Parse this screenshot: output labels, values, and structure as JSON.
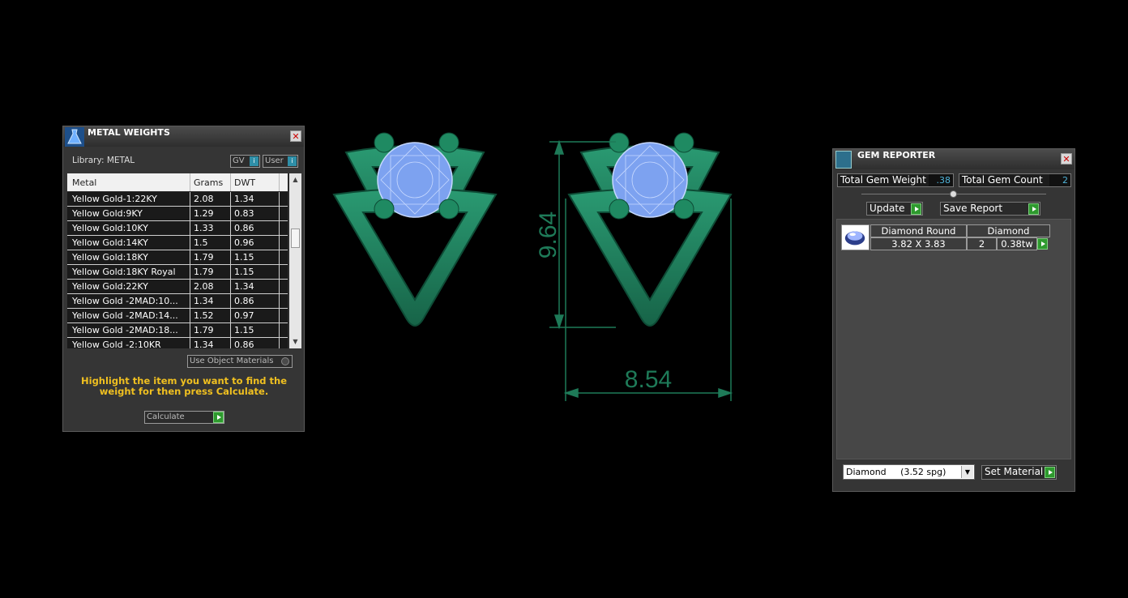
{
  "metal_weights": {
    "title": "METAL WEIGHTS",
    "library_label": "Library: METAL",
    "gv_label": "GV",
    "user_label": "User",
    "columns": [
      "Metal",
      "Grams",
      "DWT"
    ],
    "rows": [
      [
        "Yellow Gold-1:22KY",
        "2.08",
        "1.34"
      ],
      [
        "Yellow Gold:9KY",
        "1.29",
        "0.83"
      ],
      [
        "Yellow Gold:10KY",
        "1.33",
        "0.86"
      ],
      [
        "Yellow Gold:14KY",
        "1.5",
        "0.96"
      ],
      [
        "Yellow Gold:18KY",
        "1.79",
        "1.15"
      ],
      [
        "Yellow Gold:18KY Royal",
        "1.79",
        "1.15"
      ],
      [
        "Yellow Gold:22KY",
        "2.08",
        "1.34"
      ],
      [
        "Yellow Gold -2MAD:10...",
        "1.34",
        "0.86"
      ],
      [
        "Yellow Gold -2MAD:14...",
        "1.52",
        "0.97"
      ],
      [
        "Yellow Gold -2MAD:18...",
        "1.79",
        "1.15"
      ],
      [
        "Yellow Gold -2:10KR",
        "1.34",
        "0.86"
      ]
    ],
    "use_object_materials": "Use Object Materials",
    "hint": "Highlight the item you want to find the weight for then press Calculate.",
    "calculate_label": "Calculate"
  },
  "drawing": {
    "height_dim": "9.64",
    "width_dim": "8.54",
    "metal_color": "#1e7a58",
    "stone_color": "#7da2f0"
  },
  "gem_reporter": {
    "title": "GEM REPORTER",
    "total_weight_label": "Total Gem Weight",
    "total_weight_value": ".38",
    "total_count_label": "Total Gem Count",
    "total_count_value": "2",
    "update_label": "Update",
    "save_report_label": "Save Report",
    "gem": {
      "shape": "Diamond Round",
      "material": "Diamond",
      "size": "3.82 X 3.83",
      "count": "2",
      "weight": "0.38tw"
    },
    "material_dropdown": "Diamond     (3.52 spg)",
    "set_material_label": "Set Material"
  }
}
